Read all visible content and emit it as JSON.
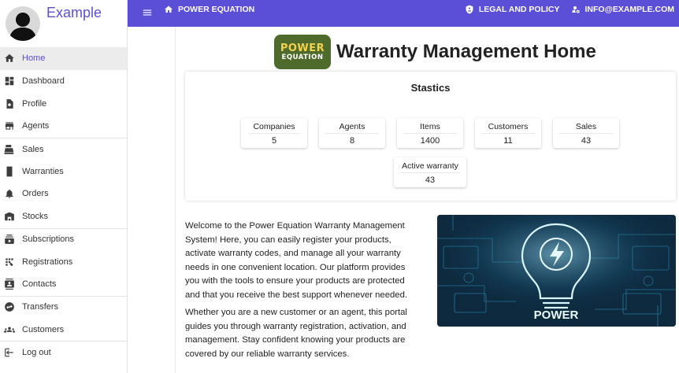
{
  "sidebar": {
    "brand": "Example",
    "items": [
      {
        "label": "Home",
        "icon": "home-icon"
      },
      {
        "label": "Dashboard",
        "icon": "dashboard-icon"
      },
      {
        "label": "Profile",
        "icon": "profile-icon"
      },
      {
        "label": "Agents",
        "icon": "store-icon"
      },
      {
        "label": "Sales",
        "icon": "cash-register-icon"
      },
      {
        "label": "Warranties",
        "icon": "warranty-icon"
      },
      {
        "label": "Orders",
        "icon": "bell-icon"
      },
      {
        "label": "Stocks",
        "icon": "warehouse-icon"
      },
      {
        "label": "Subscriptions",
        "icon": "subscriptions-icon"
      },
      {
        "label": "Registrations",
        "icon": "app-registration-icon"
      },
      {
        "label": "Contacts",
        "icon": "contacts-icon"
      },
      {
        "label": "Transfers",
        "icon": "transfer-icon"
      },
      {
        "label": "Customers",
        "icon": "groups-icon"
      },
      {
        "label": "Log out",
        "icon": "logout-icon"
      }
    ]
  },
  "topbar": {
    "breadcrumb": "POWER EQUATION",
    "legal": "LEGAL AND POLICY",
    "email": "INFO@EXAMPLE.COM"
  },
  "logo": {
    "top": "POWER",
    "bottom": "EQUATION"
  },
  "page_title": "Warranty Management Home",
  "stats": {
    "title": "Stastics",
    "tiles": [
      {
        "label": "Companies",
        "value": "5"
      },
      {
        "label": "Agents",
        "value": "8"
      },
      {
        "label": "Items",
        "value": "1400"
      },
      {
        "label": "Customers",
        "value": "11"
      },
      {
        "label": "Sales",
        "value": "43"
      },
      {
        "label": "Active warranty",
        "value": "43"
      }
    ]
  },
  "intro": {
    "p1": "Welcome to the Power Equation Warranty Management System! Here, you can easily register your products, activate warranty codes, and manage all your warranty needs in one convenient location. Our platform provides you with the tools to ensure your products are protected and that you receive the best support whenever needed.",
    "p2": "Whether you are a new customer or an agent, this portal guides you through warranty registration, activation, and management. Stay confident knowing your products are covered by our reliable warranty services."
  },
  "hero": {
    "label": "POWER"
  },
  "colors": {
    "accent": "#5b4fd8",
    "logo_bg": "#4e6b2c",
    "logo_text": "#f5d24a"
  }
}
